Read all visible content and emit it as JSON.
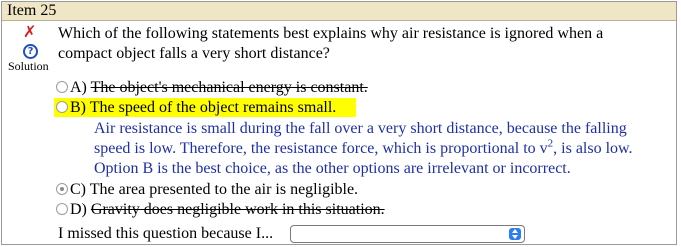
{
  "item": {
    "title": "Item 25"
  },
  "status": {
    "icon": "x-mark-icon"
  },
  "solution": {
    "label": "Solution",
    "icon": "question-circle-icon"
  },
  "question": {
    "text": "Which of the following statements best explains why air resistance is ignored when a compact object falls a very short distance?"
  },
  "options": [
    {
      "letter": "A)",
      "text": "The object's mechanical energy is constant.",
      "struck": true,
      "selected": false
    },
    {
      "letter": "B)",
      "text": "The speed of the object remains small.",
      "struck": false,
      "selected": false,
      "highlighted": true
    },
    {
      "letter": "C)",
      "text": "The area presented to the air is negligible.",
      "struck": false,
      "selected": true
    },
    {
      "letter": "D)",
      "text": "Gravity does negligible work in this situation.",
      "struck": true,
      "selected": false
    }
  ],
  "explanation": {
    "line1": "Air resistance is small during the fall over a very short distance, because the falling",
    "line2_pre": "speed is low. Therefore, the resistance force, which is proportional to v",
    "line2_sup": "2",
    "line2_post": ", is also low.",
    "line3": "Option B is the best choice, as the other options are irrelevant or incorrect."
  },
  "missed": {
    "label": "I missed this question because I...",
    "selected_value": ""
  },
  "colors": {
    "header_bg": "#efe6c6",
    "highlight": "#ffff00",
    "explanation": "#1f2fa6",
    "x_mark": "#d81e1e",
    "select_arrow": "#2d7df2"
  }
}
